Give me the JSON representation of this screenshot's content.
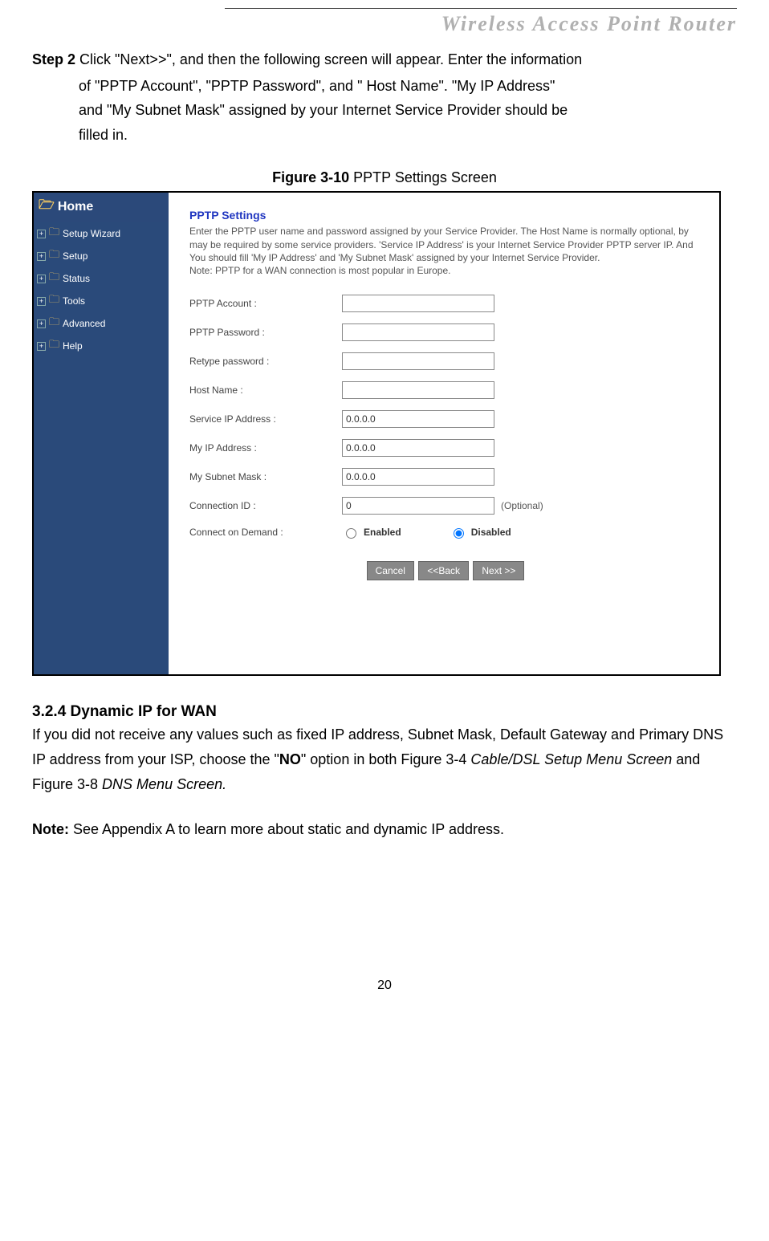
{
  "header": {
    "title": "Wireless Access Point Router"
  },
  "step": {
    "label": "Step 2",
    "line1": " Click \"Next>>\", and then the following screen will appear. Enter the information",
    "line2": "of \"PPTP Account\", \"PPTP Password\", and \" Host Name\". \"My IP Address\"",
    "line3": "and \"My Subnet Mask\" assigned by your Internet Service Provider should be",
    "line4": "filled in."
  },
  "figure": {
    "num": "Figure 3-10",
    "caption": " PPTP Settings Screen"
  },
  "sidebar": {
    "home": "Home",
    "items": [
      {
        "label": "Setup Wizard"
      },
      {
        "label": "Setup"
      },
      {
        "label": "Status"
      },
      {
        "label": "Tools"
      },
      {
        "label": "Advanced"
      },
      {
        "label": "Help"
      }
    ]
  },
  "settings": {
    "title": "PPTP Settings",
    "desc": "Enter the PPTP user name and password assigned by your Service Provider. The Host Name is normally optional, by may be required by some service providers. 'Service IP Address' is your Internet Service Provider PPTP server IP. And You should fill 'My IP Address' and 'My Subnet Mask' assigned by your Internet Service Provider.\nNote: PPTP for a WAN connection is most popular in Europe.",
    "fields": {
      "account": {
        "label": "PPTP Account :",
        "value": ""
      },
      "password": {
        "label": "PPTP Password :",
        "value": ""
      },
      "retype": {
        "label": "Retype password :",
        "value": ""
      },
      "host": {
        "label": "Host Name :",
        "value": ""
      },
      "serviceip": {
        "label": "Service IP Address :",
        "value": "0.0.0.0"
      },
      "myip": {
        "label": "My IP Address :",
        "value": "0.0.0.0"
      },
      "mysubnet": {
        "label": "My Subnet Mask :",
        "value": "0.0.0.0"
      },
      "connid": {
        "label": "Connection ID :",
        "value": "0",
        "suffix": "(Optional)"
      },
      "demand": {
        "label": "Connect on Demand :",
        "enabled": "Enabled",
        "disabled": "Disabled"
      }
    },
    "buttons": {
      "cancel": "Cancel",
      "back": "<<Back",
      "next": "Next >>"
    }
  },
  "section": {
    "title": "3.2.4 Dynamic IP for WAN",
    "p1a": "If you did not receive any values such as fixed IP address, Subnet Mask, Default Gateway and Primary DNS IP address from your ISP, choose the \"",
    "p1b": "NO",
    "p1c": "\" option in both Figure 3-4 ",
    "p1d": "Cable/DSL Setup Menu Screen",
    "p1e": " and Figure 3-8 ",
    "p1f": "DNS Menu Screen.",
    "note_label": "Note:",
    "note_text": " See Appendix A to learn more about static and dynamic IP address."
  },
  "page_number": "20"
}
